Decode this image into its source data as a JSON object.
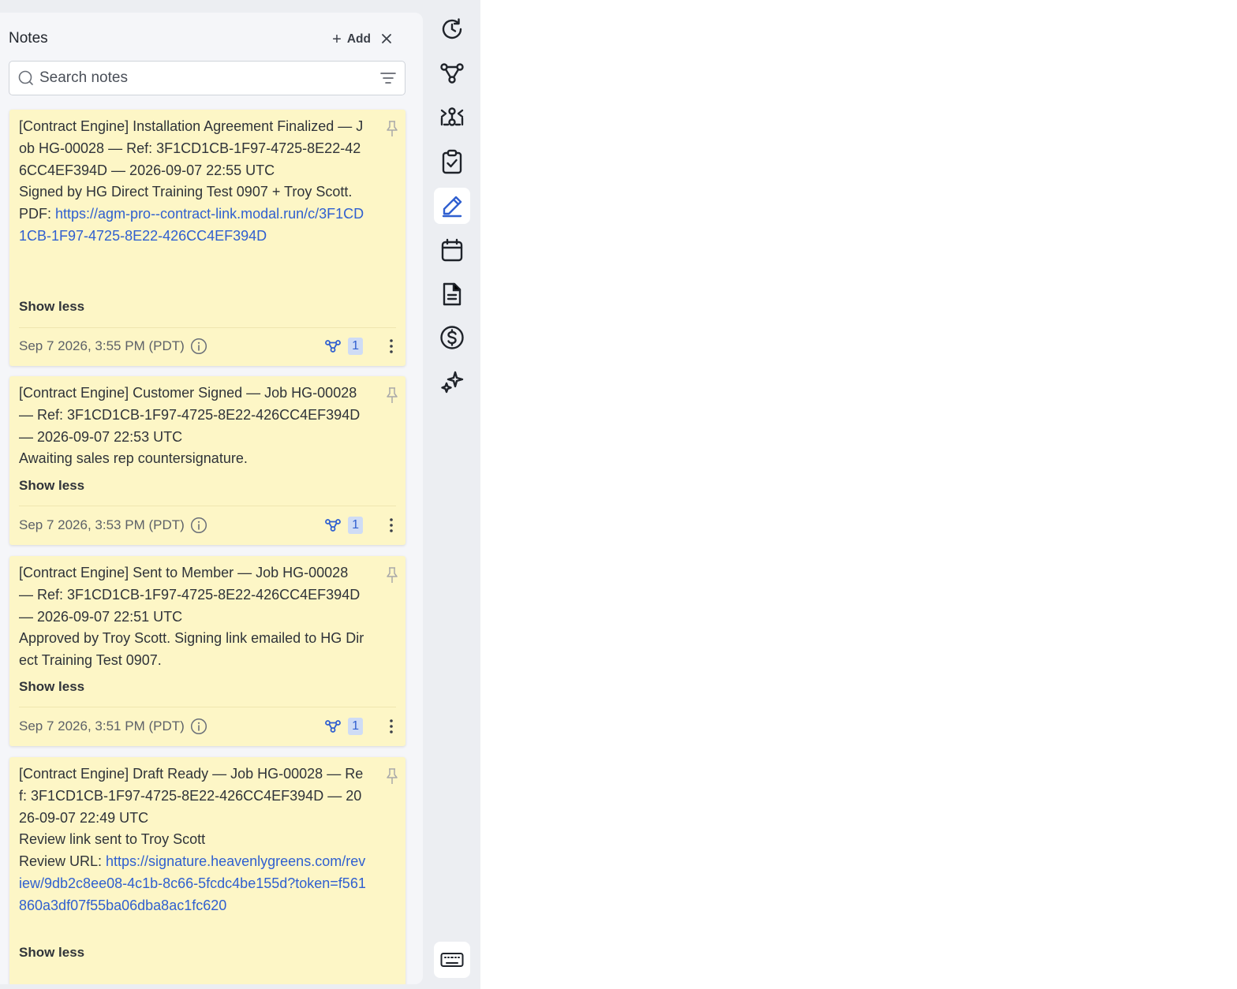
{
  "panel": {
    "title": "Notes",
    "add_label": "Add",
    "search_placeholder": "Search notes"
  },
  "notes": [
    {
      "text": "[Contract Engine] Installation Agreement Finalized — Job HG-00028 — Ref: 3F1CD1CB-1F97-4725-8E22-426CC4EF394D — 2026-09-07 22:55 UTC\nSigned by HG Direct Training Test 0907 + Troy Scott.\nPDF: ",
      "link": "https://agm-pro--contract-link.modal.run/c/3F1CD1CB-1F97-4725-8E22-426CC4EF394D",
      "toggle": "Show less",
      "timestamp": "Sep 7 2026, 3:55 PM (PDT)",
      "related_count": "1"
    },
    {
      "text": "[Contract Engine] Customer Signed — Job HG-00028 — Ref: 3F1CD1CB-1F97-4725-8E22-426CC4EF394D — 2026-09-07 22:53 UTC\nAwaiting sales rep countersignature.",
      "toggle": "Show less",
      "timestamp": "Sep 7 2026, 3:53 PM (PDT)",
      "related_count": "1"
    },
    {
      "text": "[Contract Engine] Sent to Member — Job HG-00028 — Ref: 3F1CD1CB-1F97-4725-8E22-426CC4EF394D — 2026-09-07 22:51 UTC\nApproved by Troy Scott. Signing link emailed to HG Direct Training Test 0907.",
      "toggle": "Show less",
      "timestamp": "Sep 7 2026, 3:51 PM (PDT)",
      "related_count": "1"
    },
    {
      "text": "[Contract Engine] Draft Ready — Job HG-00028 — Ref: 3F1CD1CB-1F97-4725-8E22-426CC4EF394D — 2026-09-07 22:49 UTC\nReview link sent to Troy Scott\nReview URL: ",
      "link": "https://signature.heavenlygreens.com/review/9db2c8ee08-4c1b-8c66-5fcdc4be155d?token=f561860a3df07f55ba06dba8ac1fc620",
      "toggle": "Show less"
    }
  ],
  "rail": {
    "icons": [
      "history-icon",
      "workflow-icon",
      "network-icon",
      "clipboard-check-icon",
      "pen-icon",
      "calendar-icon",
      "document-icon",
      "dollar-icon",
      "sparkles-icon"
    ],
    "active": "pen-icon",
    "bottom_icon": "keyboard-icon"
  },
  "colors": {
    "note_bg": "#fdf6c6",
    "link": "#2f5fd0",
    "accent": "#2f5fd0",
    "panel_bg": "#f5f6f9"
  }
}
